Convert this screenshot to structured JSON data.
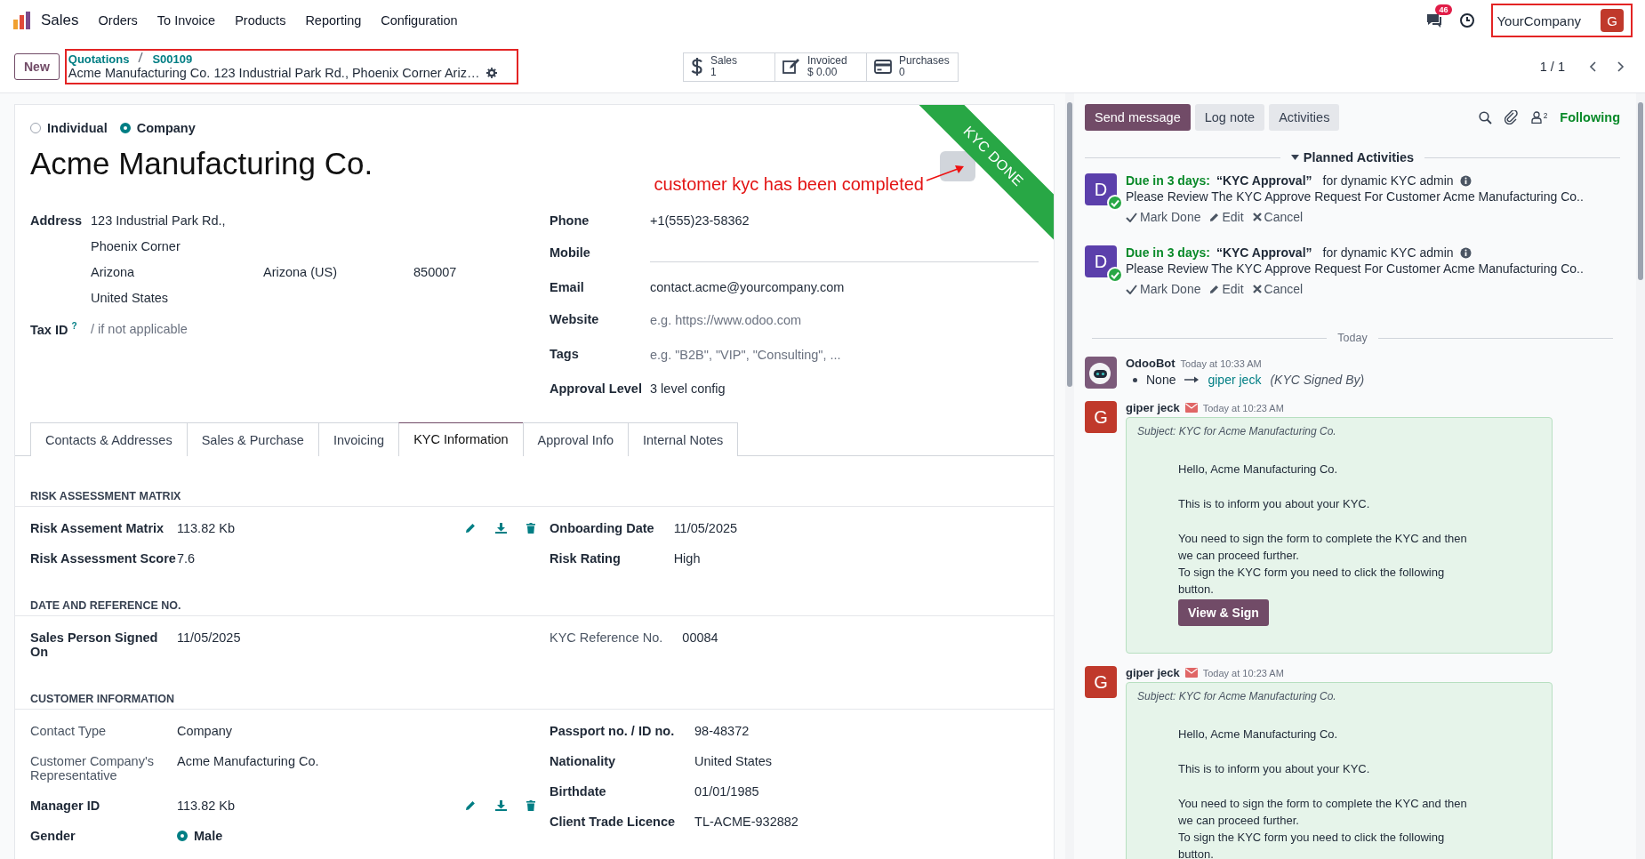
{
  "navbar": {
    "app": "Sales",
    "menu": [
      "Orders",
      "To Invoice",
      "Products",
      "Reporting",
      "Configuration"
    ],
    "message_count": "46",
    "company": "YourCompany",
    "avatar": "G"
  },
  "control_panel": {
    "new_button": "New",
    "breadcrumb": [
      "Quotations",
      "S00109"
    ],
    "record_title": "Acme Manufacturing Co. 123 Industrial Park Rd., Phoenix Corner Ariz…",
    "smart_buttons": [
      {
        "kind": "dollar",
        "label": "Sales",
        "value": "1"
      },
      {
        "kind": "edit",
        "label": "Invoiced",
        "value": "$ 0.00"
      },
      {
        "kind": "card",
        "label": "Purchases",
        "value": "0"
      }
    ],
    "pager": "1 / 1"
  },
  "form": {
    "company_type": [
      {
        "label": "Individual",
        "selected": false
      },
      {
        "label": "Company",
        "selected": true
      }
    ],
    "name": "Acme Manufacturing Co.",
    "ribbon": "KYC DONE",
    "annotation": "customer kyc has been completed",
    "address": {
      "label": "Address",
      "street": "123 Industrial Park Rd.,",
      "street2": "Phoenix Corner",
      "city": "Arizona",
      "state": "Arizona (US)",
      "zip": "850007",
      "country": "United States"
    },
    "tax_id": {
      "label": "Tax ID",
      "help": "?",
      "placeholder": "/ if not applicable"
    },
    "contact_fields": [
      {
        "kind": "text",
        "label": "Phone",
        "value": "+1(555)23-58362"
      },
      {
        "kind": "input",
        "label": "Mobile"
      },
      {
        "kind": "text",
        "label": "Email",
        "value": "contact.acme@yourcompany.com"
      },
      {
        "kind": "input",
        "label": "Website",
        "placeholder": "e.g. https://www.odoo.com"
      },
      {
        "kind": "input",
        "label": "Tags",
        "placeholder": "e.g. \"B2B\", \"VIP\", \"Consulting\", ..."
      },
      {
        "kind": "text",
        "label": "Approval Level",
        "value": "3 level config"
      }
    ],
    "tabs": [
      {
        "label": "Contacts & Addresses",
        "selected": false
      },
      {
        "label": "Sales & Purchase",
        "selected": false
      },
      {
        "label": "Invoicing",
        "selected": false
      },
      {
        "label": "KYC Information",
        "selected": true
      },
      {
        "label": "Approval Info",
        "selected": false
      },
      {
        "label": "Internal Notes",
        "selected": false
      }
    ],
    "sections": [
      {
        "title": "RISK ASSESSMENT MATRIX",
        "left": [
          {
            "kind": "file",
            "label": "Risk Assement Matrix",
            "value": "113.82 Kb",
            "muted": false
          },
          {
            "kind": "text",
            "label": "Risk Assessment Score",
            "value": "7.6",
            "muted": false
          }
        ],
        "right": [
          {
            "kind": "text",
            "label": "Onboarding Date",
            "value": "11/05/2025",
            "muted": false
          },
          {
            "kind": "text",
            "label": "Risk Rating",
            "value": "High",
            "muted": false
          }
        ]
      },
      {
        "title": "DATE AND REFERENCE NO.",
        "left": [
          {
            "kind": "text",
            "label": "Sales Person Signed On",
            "value": "11/05/2025",
            "muted": false
          }
        ],
        "right": [
          {
            "kind": "text",
            "label": "KYC Reference No.",
            "value": "00084",
            "muted": true
          }
        ]
      },
      {
        "title": "CUSTOMER INFORMATION",
        "left": [
          {
            "kind": "text",
            "label": "Contact Type",
            "value": "Company",
            "muted": true
          },
          {
            "kind": "text",
            "label": "Customer Company's Representative",
            "value": "Acme Manufacturing Co.",
            "muted": true
          },
          {
            "kind": "file",
            "label": "Manager ID",
            "value": "113.82 Kb",
            "muted": false
          },
          {
            "kind": "radio",
            "label": "Gender",
            "value": "Male",
            "muted": false,
            "selected": true
          }
        ],
        "right": [
          {
            "kind": "text",
            "label": "Passport no. / ID no.",
            "value": "98-48372",
            "muted": false
          },
          {
            "kind": "text",
            "label": "Nationality",
            "value": "United States",
            "muted": false
          },
          {
            "kind": "text",
            "label": "Birthdate",
            "value": "01/01/1985",
            "muted": false
          },
          {
            "kind": "text",
            "label": "Client Trade Licence",
            "value": "TL-ACME-932882",
            "muted": false
          }
        ]
      }
    ]
  },
  "chatter": {
    "buttons": [
      {
        "label": "Send message",
        "selected": true
      },
      {
        "label": "Log note",
        "selected": false
      },
      {
        "label": "Activities",
        "selected": false
      }
    ],
    "followers": "2",
    "following": "Following",
    "planned": {
      "title": "Planned Activities",
      "expanded": true,
      "activities": [
        {
          "avatar": "D",
          "due": "Due in 3 days:",
          "summary": "“KYC Approval”",
          "assignee": "for dynamic KYC admin",
          "note": "Please Review The KYC Approve Request For Customer Acme Manufacturing Co..",
          "actions": [
            "Mark Done",
            "Edit",
            "Cancel"
          ]
        },
        {
          "avatar": "D",
          "due": "Due in 3 days:",
          "summary": "“KYC Approval”",
          "assignee": "for dynamic KYC admin",
          "note": "Please Review The KYC Approve Request For Customer Acme Manufacturing Co..",
          "actions": [
            "Mark Done",
            "Edit",
            "Cancel"
          ]
        }
      ]
    },
    "date_separator": "Today",
    "messages": [
      {
        "kind": "tracking",
        "author": "OdooBot",
        "time": "Today at 10:33 AM",
        "old": "None",
        "new": "giper jeck",
        "field": "(KYC Signed By)"
      },
      {
        "kind": "email",
        "author": "giper jeck",
        "avatar": "G",
        "time": "Today at 10:23 AM",
        "subject": "Subject: KYC for Acme Manufacturing Co.",
        "paragraphs": [
          [
            "Hello, Acme Manufacturing Co."
          ],
          [
            "This is to inform you about your KYC."
          ],
          [
            "You need to sign the form to complete the KYC and then we can proceed further.",
            "To sign the KYC form you need to click the following button."
          ]
        ],
        "button": "View & Sign"
      },
      {
        "kind": "email",
        "author": "giper jeck",
        "avatar": "G",
        "time": "Today at 10:23 AM",
        "subject": "Subject: KYC for Acme Manufacturing Co.",
        "paragraphs": [
          [
            "Hello, Acme Manufacturing Co."
          ],
          [
            "This is to inform you about your KYC."
          ],
          [
            "You need to sign the form to complete the KYC and then we can proceed further.",
            "To sign the KYC form you need to click the following button."
          ]
        ]
      }
    ]
  }
}
